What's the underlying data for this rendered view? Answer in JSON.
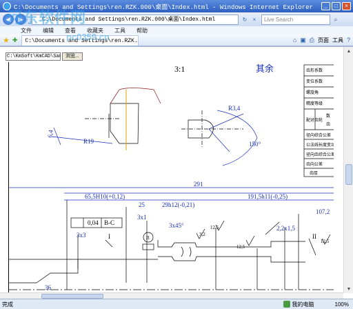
{
  "window": {
    "title": "C:\\Documents and Settings\\ren.RZK.000\\桌面\\Index.html - Windows Internet Explorer",
    "min_glyph": "_",
    "max_glyph": "□",
    "close_glyph": "×"
  },
  "addressbar": {
    "back_glyph": "◀",
    "forward_glyph": "▶",
    "url": "C:\\Documents and Settings\\ren.RZK.000\\桌面\\Index.html",
    "refresh_glyph": "↻",
    "stop_glyph": "×",
    "search_placeholder": "Live Search",
    "search_glyph": "⌕"
  },
  "menu": {
    "items": [
      "文件",
      "编辑",
      "查看",
      "收藏夹",
      "工具",
      "帮助"
    ]
  },
  "favorites": {
    "star_glyph": "★",
    "add_glyph": "✚",
    "tab_label": "C:\\Documents and Settings\\ren.RZK.000\\桌面",
    "home_glyph": "⌂",
    "feed_glyph": "▣",
    "print_glyph": "⎙",
    "page_label": "页面",
    "tools_label": "工具",
    "help_glyph": "?"
  },
  "page": {
    "file_value": "C:\\KmSoft\\KmCAD\\Sampl",
    "browse_label": "浏览..."
  },
  "drawing": {
    "scale_label": "3:1",
    "rest_label": "其余",
    "dims": {
      "d291": "291",
      "d65": "65,5H10(+0,12)",
      "d191": "191,5h11(-0,25)",
      "d25": "25",
      "d29": "29h12(-0,21)",
      "d107": "107,2",
      "d3x1": "3x1",
      "d3x45": "3x45°",
      "d3x3": "3x3",
      "d22": "2,2x1,5",
      "d12_5a": "12,5",
      "d12_5b": "12,5",
      "d12_5c": "12,5",
      "d3_2": "3,2",
      "d150": "150°",
      "dR34": "R3,4",
      "dR19": "R19",
      "d6_4": "6,4",
      "tol": "0,04",
      "tol_ref": "B-C",
      "mark_I": "I",
      "mark_II": "II",
      "mark_B": "B",
      "d36": "36"
    },
    "table_rows": [
      "齿形系数",
      "变位系数",
      "螺旋角",
      "精度等级",
      "配对齿轮",
      "径向综合公差",
      "公法线长度变动",
      "径向齿综合公差",
      "齿向公差",
      "齿厚"
    ],
    "table_col2": [
      "数",
      "齿"
    ]
  },
  "status": {
    "text": "完成",
    "zone": "我的电脑",
    "zoom": "100%"
  },
  "watermark": {
    "text": "河东软件网",
    "url": "pc0359.cn"
  }
}
